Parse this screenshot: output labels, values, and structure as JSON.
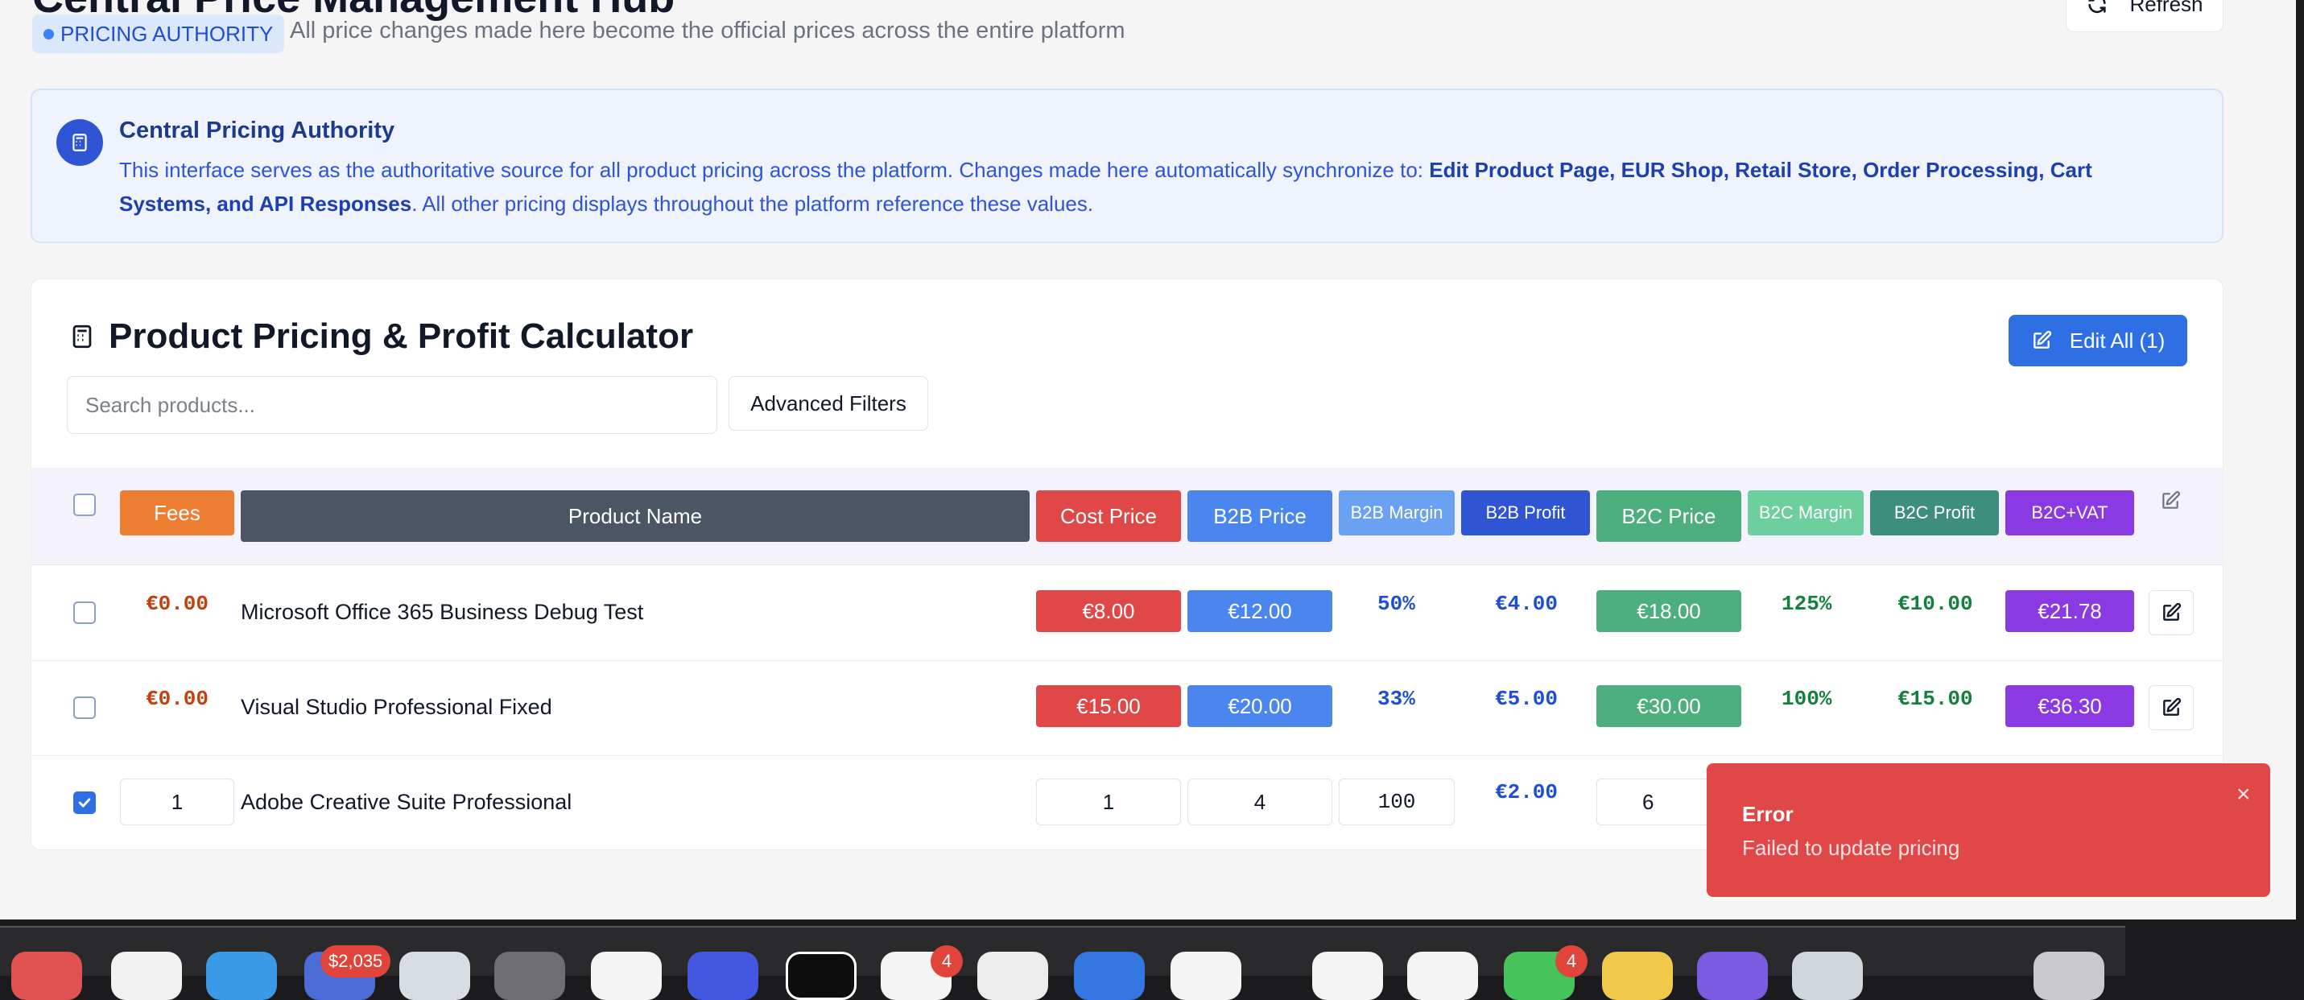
{
  "header": {
    "title": "Central Price Management Hub",
    "badge": "PRICING AUTHORITY",
    "subtitle": "All price changes made here become the official prices across the entire platform",
    "refresh_label": "Refresh"
  },
  "info": {
    "title": "Central Pricing Authority",
    "text_before": "This interface serves as the authoritative source for all product pricing across the platform. Changes made here automatically synchronize to: ",
    "text_bold": "Edit Product Page, EUR Shop, Retail Store, Order Processing, Cart Systems, and API Responses",
    "text_after": ". All other pricing displays throughout the platform reference these values."
  },
  "calculator": {
    "title": "Product Pricing & Profit Calculator",
    "edit_all_label": "Edit All (1)",
    "search_placeholder": "Search products...",
    "advanced_filters_label": "Advanced Filters"
  },
  "table": {
    "headers": {
      "fees": "Fees",
      "name": "Product Name",
      "cost": "Cost Price",
      "b2b_price": "B2B Price",
      "b2b_margin": "B2B Margin",
      "b2b_profit": "B2B Profit",
      "b2c_price": "B2C Price",
      "b2c_margin": "B2C Margin",
      "b2c_profit": "B2C Profit",
      "b2c_vat": "B2C+VAT"
    },
    "rows": [
      {
        "fees": "€0.00",
        "name": "Microsoft Office 365 Business Debug Test",
        "cost": "€8.00",
        "b2b_price": "€12.00",
        "b2b_margin": "50%",
        "b2b_profit": "€4.00",
        "b2c_price": "€18.00",
        "b2c_margin": "125%",
        "b2c_profit": "€10.00",
        "b2c_vat": "€21.78"
      },
      {
        "fees": "€0.00",
        "name": "Visual Studio Professional Fixed",
        "cost": "€15.00",
        "b2b_price": "€20.00",
        "b2b_margin": "33%",
        "b2b_profit": "€5.00",
        "b2c_price": "€30.00",
        "b2c_margin": "100%",
        "b2c_profit": "€15.00",
        "b2c_vat": "€36.30"
      }
    ],
    "editing_row": {
      "fees": "1",
      "name": "Adobe Creative Suite Professional",
      "cost": "1",
      "b2b_price": "4",
      "b2b_margin": "100",
      "b2b_profit": "€2.00",
      "b2c_price": "6"
    }
  },
  "toast": {
    "title": "Error",
    "message": "Failed to update pricing",
    "close": "×"
  },
  "dock": {
    "badge_1": "$2,035",
    "badge_2": "4",
    "badge_3": "4"
  },
  "colors": {
    "fees": "#ed7d31",
    "name": "#4b5563",
    "cost": "#e04848",
    "b2b_price": "#4a86ee",
    "b2b_margin": "#6aa1f2",
    "b2b_profit": "#2f55d4",
    "b2c_price": "#4caf7d",
    "b2c_margin": "#6dcf9d",
    "b2c_profit": "#3d8f7c",
    "b2c_vat": "#8b39e3"
  }
}
